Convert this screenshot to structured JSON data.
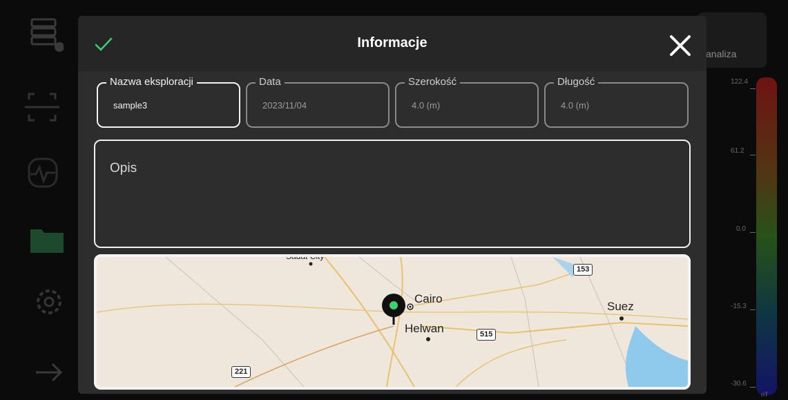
{
  "colors": {
    "accent_check": "#3ad36d",
    "dialog_bg": "#2d2d2d",
    "pin_dot": "#3ad36d"
  },
  "sidebar": {
    "icons": [
      "server-icon",
      "scan-icon",
      "signal-icon",
      "folder-icon",
      "gear-icon",
      "arrow-right-icon"
    ]
  },
  "right_panel": {
    "analiza_label": "analiza",
    "scale_ticks": [
      "122.4",
      "61.2",
      "0.0",
      "-15.3",
      "-30.6"
    ],
    "unit": "nT"
  },
  "dialog": {
    "title": "Informacje",
    "fields": [
      {
        "label": "Nazwa eksploracji",
        "value": "sample3"
      },
      {
        "label": "Data",
        "value": "2023/11/04"
      },
      {
        "label": "Szerokość",
        "value": "4.0 (m)"
      },
      {
        "label": "Długość",
        "value": "4.0 (m)"
      }
    ],
    "description_placeholder": "Opis",
    "map": {
      "places": [
        "Cairo",
        "Helwan",
        "Suez"
      ],
      "roads": [
        "153",
        "515",
        "221"
      ],
      "partial_label": "Sadat City"
    }
  }
}
